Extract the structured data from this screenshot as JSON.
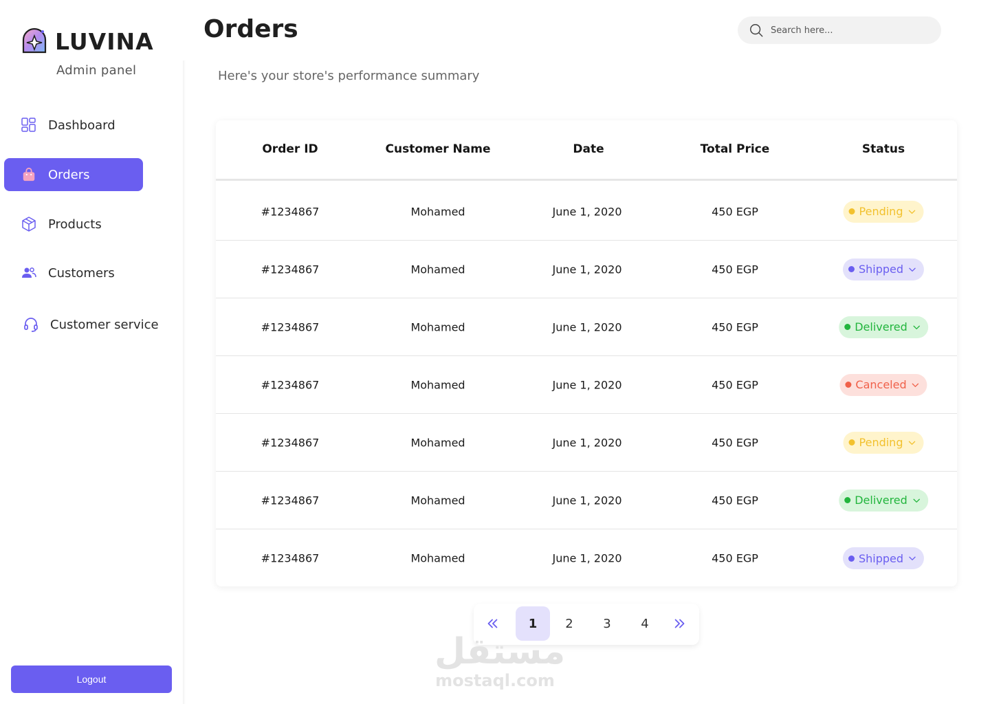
{
  "brand": {
    "name": "LUVINA",
    "subtitle": "Admin panel"
  },
  "sidebar": {
    "items": [
      {
        "label": "Dashboard",
        "icon": "grid-icon",
        "active": false
      },
      {
        "label": "Orders",
        "icon": "shopping-bag-icon",
        "active": true
      },
      {
        "label": "Products",
        "icon": "box-icon",
        "active": false
      },
      {
        "label": "Customers",
        "icon": "users-icon",
        "active": false
      },
      {
        "label": "Customer service",
        "icon": "headset-icon",
        "active": false
      }
    ],
    "logout_label": "Logout"
  },
  "header": {
    "title": "Orders",
    "subtitle": "Here's your store's performance summary",
    "search_placeholder": "Search here..."
  },
  "table": {
    "columns": [
      "Order ID",
      "Customer Name",
      "Date",
      "Total Price",
      "Status"
    ],
    "rows": [
      {
        "id": "#1234867",
        "customer": "Mohamed",
        "date": "June 1, 2020",
        "price": "450 EGP",
        "status": "Pending"
      },
      {
        "id": "#1234867",
        "customer": "Mohamed",
        "date": "June 1, 2020",
        "price": "450 EGP",
        "status": "Shipped"
      },
      {
        "id": "#1234867",
        "customer": "Mohamed",
        "date": "June 1, 2020",
        "price": "450 EGP",
        "status": "Delivered"
      },
      {
        "id": "#1234867",
        "customer": "Mohamed",
        "date": "June 1, 2020",
        "price": "450 EGP",
        "status": "Canceled"
      },
      {
        "id": "#1234867",
        "customer": "Mohamed",
        "date": "June 1, 2020",
        "price": "450 EGP",
        "status": "Pending"
      },
      {
        "id": "#1234867",
        "customer": "Mohamed",
        "date": "June 1, 2020",
        "price": "450 EGP",
        "status": "Delivered"
      },
      {
        "id": "#1234867",
        "customer": "Mohamed",
        "date": "June 1, 2020",
        "price": "450 EGP",
        "status": "Shipped"
      }
    ]
  },
  "status_colors": {
    "Pending": {
      "bg": "#fff4cc",
      "fg": "#f2c12e"
    },
    "Shipped": {
      "bg": "#e3e1fb",
      "fg": "#6a5ef0"
    },
    "Delivered": {
      "bg": "#d8f5dc",
      "fg": "#22b53d"
    },
    "Canceled": {
      "bg": "#fde0dc",
      "fg": "#f0614a"
    }
  },
  "pagination": {
    "pages": [
      "1",
      "2",
      "3",
      "4"
    ],
    "current": "1",
    "prev_icon": "double-chevron-left-icon",
    "next_icon": "double-chevron-right-icon"
  },
  "colors": {
    "accent": "#6a5ef0"
  },
  "watermark": {
    "arabic": "مستقل",
    "latin": "mostaql.com"
  }
}
